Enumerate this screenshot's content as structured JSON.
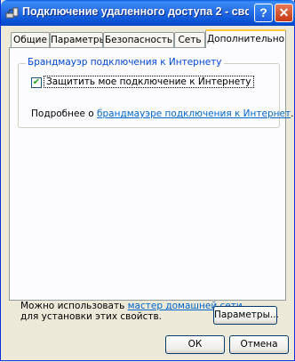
{
  "window": {
    "title": "Подключение удаленного доступа 2 - сво..."
  },
  "titlebar": {
    "help_label": "?",
    "close_label": "✕"
  },
  "tabs": [
    {
      "label": "Общие"
    },
    {
      "label": "Параметры"
    },
    {
      "label": "Безопасность"
    },
    {
      "label": "Сеть"
    },
    {
      "label": "Дополнительно"
    }
  ],
  "active_tab": "Дополнительно",
  "firewall_group": {
    "legend": "Брандмауэр подключения к Интернету",
    "checkbox_label": "Защитить мое подключение к Интернету",
    "checkbox_checked": true,
    "more_prefix": "Подробнее о ",
    "more_link": "брандмауэре подключения к Интернет",
    "more_suffix": "."
  },
  "bottom": {
    "line1_prefix": "Можно использовать ",
    "line1_link": "мастер домашней сети",
    "line2": "для установки этих свойств.",
    "params_button": "Параметры..."
  },
  "footer": {
    "ok_label": "ОК",
    "cancel_label": "Отмена"
  }
}
